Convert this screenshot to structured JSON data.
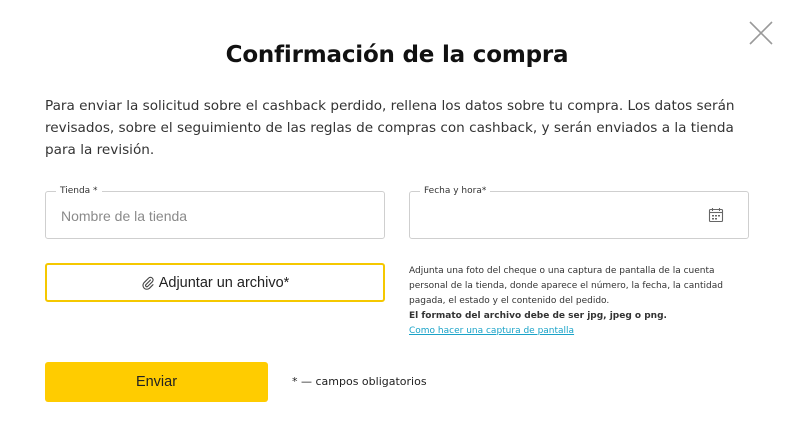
{
  "dialog": {
    "title": "Confirmación de la compra",
    "intro": "Para enviar la solicitud sobre el cashback perdido, rellena los datos sobre tu compra. Los datos serán revisados, sobre el seguimiento de las reglas de compras con cashback, y serán enviados a la tienda para la revisión.",
    "close_icon": "close-icon"
  },
  "form": {
    "store": {
      "label": "Tienda *",
      "placeholder": "Nombre de la tienda",
      "value": ""
    },
    "datetime": {
      "label": "Fecha y hora*",
      "value": "",
      "icon": "calendar-icon"
    },
    "attach": {
      "label": "Adjuntar un archivo*",
      "icon": "paperclip-icon"
    },
    "hint": {
      "text": "Adjunta una foto del cheque o una captura de pantalla de la cuenta personal de la tienda, donde aparece el número, la fecha, la cantidad pagada, el estado y el contenido del pedido.",
      "format": "El formato del archivo debe de ser jpg, jpeg o png.",
      "link": "Como hacer una captura de pantalla"
    },
    "submit_label": "Enviar",
    "required_note": "* — campos obligatorios"
  },
  "colors": {
    "accent": "#ffcc00",
    "accent_border": "#f5c800",
    "link": "#1aa3c8"
  }
}
